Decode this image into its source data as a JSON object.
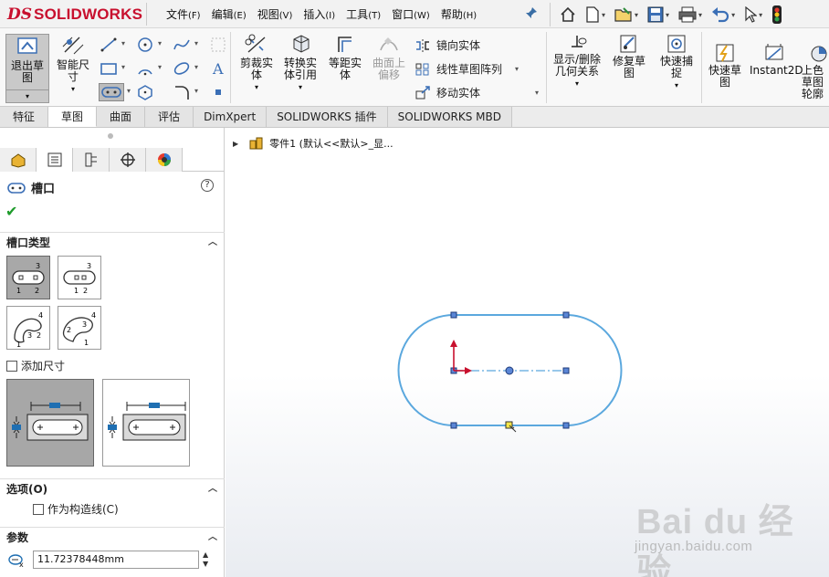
{
  "app": {
    "logo_ds": "DS",
    "logo_name": "SOLIDWORKS",
    "menus": [
      {
        "label": "文件",
        "key": "(F)"
      },
      {
        "label": "编辑",
        "key": "(E)"
      },
      {
        "label": "视图",
        "key": "(V)"
      },
      {
        "label": "插入",
        "key": "(I)"
      },
      {
        "label": "工具",
        "key": "(T)"
      },
      {
        "label": "窗口",
        "key": "(W)"
      },
      {
        "label": "帮助",
        "key": "(H)"
      }
    ],
    "quick_icons": [
      "home-icon",
      "new-document-icon",
      "open-folder-icon",
      "save-icon",
      "print-icon",
      "undo-icon",
      "select-cursor-icon",
      "traffic-light-icon"
    ]
  },
  "ribbon": {
    "exit_sketch": "退出草图",
    "smart_dimension": "智能尺寸",
    "trim": "剪裁实体",
    "convert": "转换实体引用",
    "offset": "等距实体",
    "surface_offset": "曲面上偏移",
    "mirror": "镜向实体",
    "linear_pattern": "线性草图阵列",
    "move": "移动实体",
    "show_relations": "显示/删除几何关系",
    "repair": "修复草图",
    "quick_snaps": "快速捕捉",
    "rapid_sketch": "快速草图",
    "instant2d": "Instant2D",
    "color": "上色草图轮廓"
  },
  "tabs": [
    "特征",
    "草图",
    "曲面",
    "评估",
    "DimXpert",
    "SOLIDWORKS 插件",
    "SOLIDWORKS MBD"
  ],
  "active_tab": "草图",
  "property_manager": {
    "title": "槽口",
    "help": "?",
    "ok": "✔",
    "slot_type_header": "槽口类型",
    "add_dimensions": "添加尺寸",
    "options_header": "选项(O)",
    "construction": "作为构造线(C)",
    "params_header": "参数",
    "param_value": "11.72378448mm"
  },
  "graphics": {
    "tree_label": "零件1  (默认<<默认>_显...",
    "slot_color": "#5ba8de",
    "origin_color": "#c8102e"
  },
  "watermark": {
    "logo": "Bai du 经验",
    "url": "jingyan.baidu.com"
  }
}
